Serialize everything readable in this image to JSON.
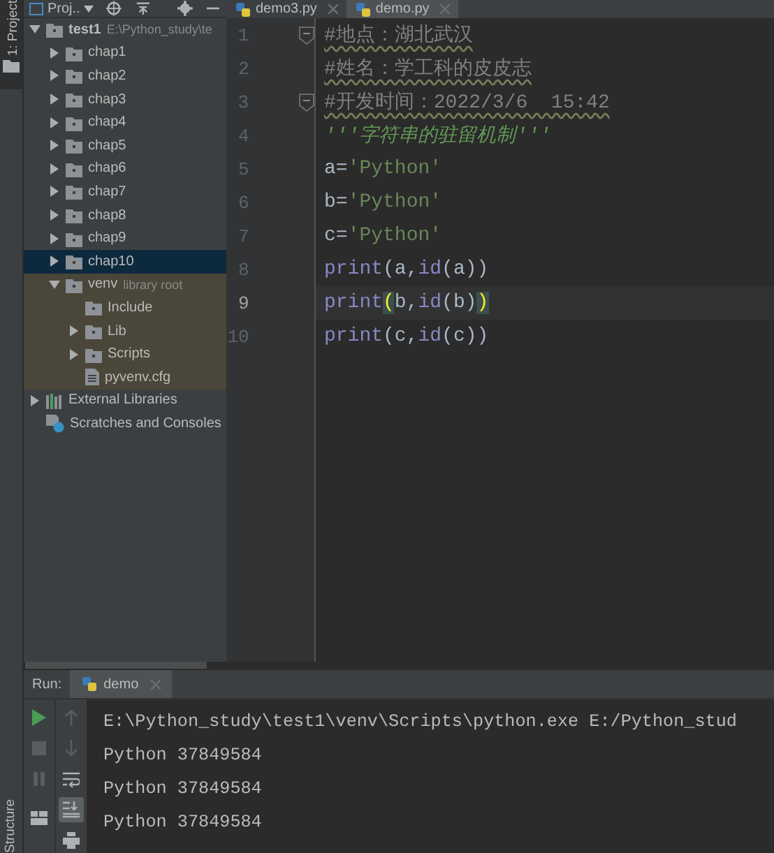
{
  "side_stripe": {
    "top_tab": "1: Project",
    "bottom_tab": "Structure"
  },
  "project_panel": {
    "view_selector": "Proj..",
    "tree": [
      {
        "label": "test1",
        "note": "E:\\Python_study\\te",
        "kind": "root",
        "expanded": true,
        "selected": false,
        "children": [
          {
            "label": "chap1",
            "kind": "folder",
            "expanded": false,
            "selected": false
          },
          {
            "label": "chap2",
            "kind": "folder",
            "expanded": false,
            "selected": false
          },
          {
            "label": "chap3",
            "kind": "folder",
            "expanded": false,
            "selected": false
          },
          {
            "label": "chap4",
            "kind": "folder",
            "expanded": false,
            "selected": false
          },
          {
            "label": "chap5",
            "kind": "folder",
            "expanded": false,
            "selected": false
          },
          {
            "label": "chap6",
            "kind": "folder",
            "expanded": false,
            "selected": false
          },
          {
            "label": "chap7",
            "kind": "folder",
            "expanded": false,
            "selected": false
          },
          {
            "label": "chap8",
            "kind": "folder",
            "expanded": false,
            "selected": false
          },
          {
            "label": "chap9",
            "kind": "folder",
            "expanded": false,
            "selected": false
          },
          {
            "label": "chap10",
            "kind": "folder",
            "expanded": false,
            "selected": true
          },
          {
            "label": "venv",
            "note": "library root",
            "kind": "folder",
            "expanded": true,
            "highlighted": true,
            "selected": false,
            "children": [
              {
                "label": "Include",
                "kind": "folder",
                "selected": false
              },
              {
                "label": "Lib",
                "kind": "folder",
                "expanded": false,
                "selected": false
              },
              {
                "label": "Scripts",
                "kind": "folder",
                "expanded": false,
                "selected": false
              },
              {
                "label": "pyvenv.cfg",
                "kind": "file",
                "selected": false
              }
            ]
          }
        ]
      },
      {
        "label": "External Libraries",
        "kind": "libraries",
        "expanded": false,
        "selected": false
      },
      {
        "label": "Scratches and Consoles",
        "kind": "scratches",
        "selected": false
      }
    ]
  },
  "editor": {
    "tabs": [
      {
        "label": "demo3.py",
        "selected": false
      },
      {
        "label": "demo.py",
        "selected": true
      }
    ],
    "lines": [
      {
        "number": "1",
        "fold": true,
        "current": false,
        "segments": [
          {
            "kind": "comment",
            "text": "#地点：湖北武汉"
          }
        ]
      },
      {
        "number": "2",
        "current": false,
        "segments": [
          {
            "kind": "comment",
            "text": "#姓名：学工科的皮皮志"
          }
        ]
      },
      {
        "number": "3",
        "fold": true,
        "current": false,
        "segments": [
          {
            "kind": "comment",
            "text": "#开发时间：2022/3/6  15:42"
          }
        ]
      },
      {
        "number": "4",
        "current": false,
        "segments": [
          {
            "kind": "docstring",
            "text": "'''字符串的驻留机制'''"
          }
        ]
      },
      {
        "number": "5",
        "current": false,
        "segments": [
          {
            "kind": "plain",
            "text": "a="
          },
          {
            "kind": "string",
            "text": "'Python'"
          }
        ]
      },
      {
        "number": "6",
        "current": false,
        "segments": [
          {
            "kind": "plain",
            "text": "b="
          },
          {
            "kind": "string",
            "text": "'Python'"
          }
        ]
      },
      {
        "number": "7",
        "current": false,
        "segments": [
          {
            "kind": "plain",
            "text": "c="
          },
          {
            "kind": "string",
            "text": "'Python'"
          }
        ]
      },
      {
        "number": "8",
        "current": false,
        "segments": [
          {
            "kind": "builtin",
            "text": "print"
          },
          {
            "kind": "plain",
            "text": "(a,"
          },
          {
            "kind": "builtin",
            "text": "id"
          },
          {
            "kind": "plain",
            "text": "(a))"
          }
        ]
      },
      {
        "number": "9",
        "current": true,
        "segments": [
          {
            "kind": "builtin",
            "text": "print"
          },
          {
            "kind": "brace",
            "text": "("
          },
          {
            "kind": "plain",
            "text": "b,"
          },
          {
            "kind": "builtin",
            "text": "id"
          },
          {
            "kind": "plain",
            "text": "(b)"
          },
          {
            "kind": "brace",
            "text": ")"
          }
        ]
      },
      {
        "number": "10",
        "current": false,
        "segments": [
          {
            "kind": "builtin",
            "text": "print"
          },
          {
            "kind": "plain",
            "text": "(c,"
          },
          {
            "kind": "builtin",
            "text": "id"
          },
          {
            "kind": "plain",
            "text": "(c))"
          }
        ]
      }
    ]
  },
  "run_panel": {
    "label": "Run:",
    "tabs": [
      {
        "label": "demo",
        "selected": true
      }
    ],
    "output": [
      "E:\\Python_study\\test1\\venv\\Scripts\\python.exe E:/Python_stud",
      "Python 37849584",
      "Python 37849584",
      "Python 37849584"
    ]
  }
}
